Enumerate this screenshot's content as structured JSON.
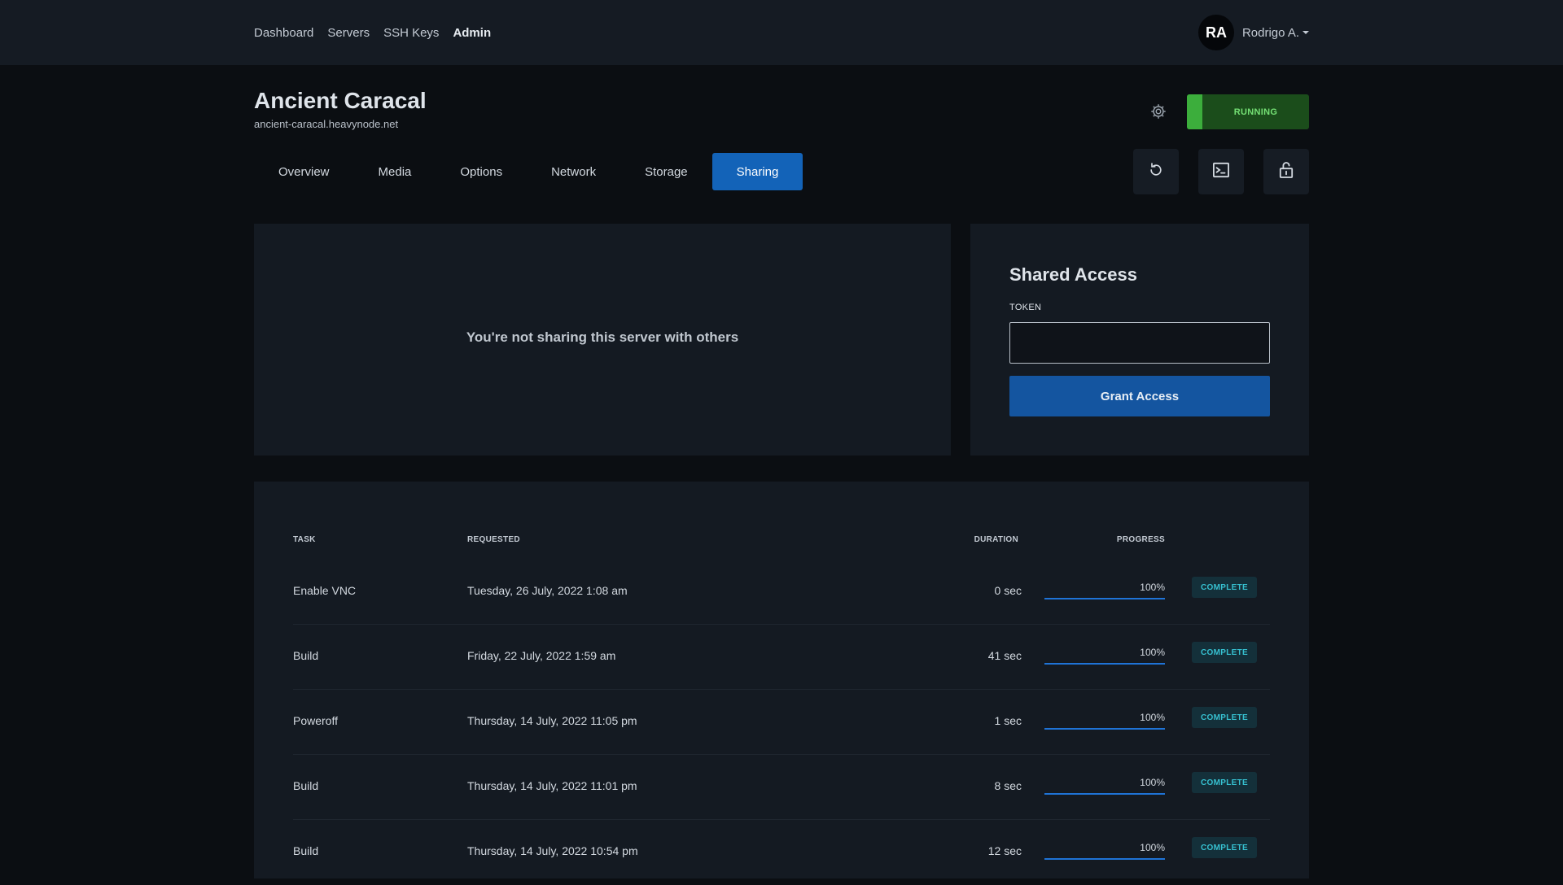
{
  "nav": {
    "links": [
      "Dashboard",
      "Servers",
      "SSH Keys",
      "Admin"
    ],
    "active": "Admin"
  },
  "user": {
    "initials": "RA",
    "name": "Rodrigo A."
  },
  "server": {
    "name": "Ancient Caracal",
    "host": "ancient-caracal.heavynode.net",
    "status": "RUNNING",
    "status_color": "#3cae3c"
  },
  "tabs": [
    "Overview",
    "Media",
    "Options",
    "Network",
    "Storage",
    "Sharing"
  ],
  "active_tab": "Sharing",
  "tools": [
    "restart-icon",
    "console-icon",
    "lock-icon"
  ],
  "sharing": {
    "empty_message": "You're not sharing this server with others",
    "title": "Shared Access",
    "token_label": "TOKEN",
    "token_value": "",
    "grant_label": "Grant Access"
  },
  "tasks": {
    "headers": {
      "task": "TASK",
      "requested": "REQUESTED",
      "duration": "DURATION",
      "progress": "PROGRESS"
    },
    "rows": [
      {
        "task": "Enable VNC",
        "requested": "Tuesday, 26 July, 2022 1:08 am",
        "duration": "0 sec",
        "progress": "100%",
        "progress_value": 100,
        "status": "COMPLETE"
      },
      {
        "task": "Build",
        "requested": "Friday, 22 July, 2022 1:59 am",
        "duration": "41 sec",
        "progress": "100%",
        "progress_value": 100,
        "status": "COMPLETE"
      },
      {
        "task": "Poweroff",
        "requested": "Thursday, 14 July, 2022 11:05 pm",
        "duration": "1 sec",
        "progress": "100%",
        "progress_value": 100,
        "status": "COMPLETE"
      },
      {
        "task": "Build",
        "requested": "Thursday, 14 July, 2022 11:01 pm",
        "duration": "8 sec",
        "progress": "100%",
        "progress_value": 100,
        "status": "COMPLETE"
      },
      {
        "task": "Build",
        "requested": "Thursday, 14 July, 2022 10:54 pm",
        "duration": "12 sec",
        "progress": "100%",
        "progress_value": 100,
        "status": "COMPLETE"
      }
    ]
  },
  "colors": {
    "accent": "#1363b8",
    "badge_text": "#36c0d0",
    "running_bg": "#1b4d1b"
  }
}
